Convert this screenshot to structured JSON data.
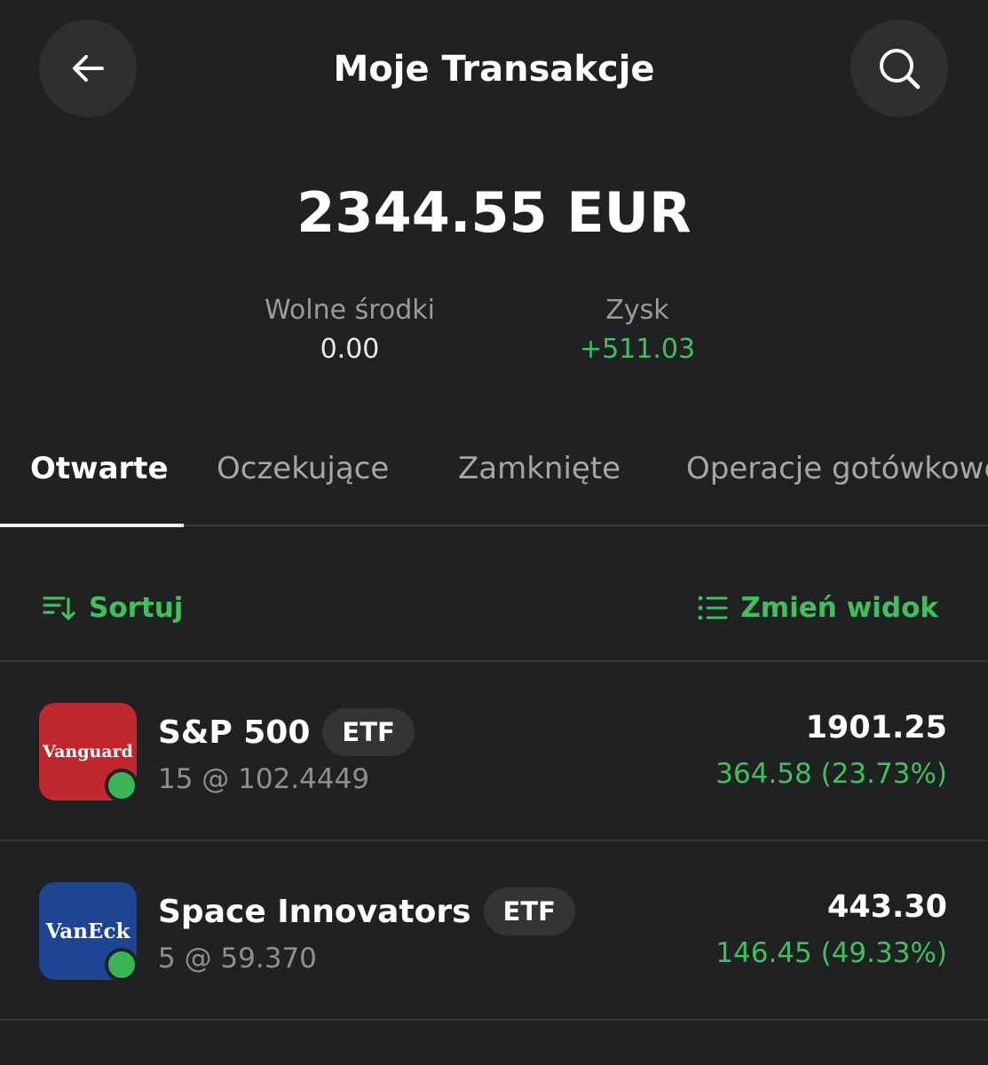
{
  "header": {
    "title": "Moje Transakcje",
    "back_icon": "arrow-left-icon",
    "search_icon": "search-icon"
  },
  "summary": {
    "balance": "2344.55 EUR",
    "free_funds_label": "Wolne środki",
    "free_funds_value": "0.00",
    "profit_label": "Zysk",
    "profit_value": "+511.03"
  },
  "tabs": [
    {
      "label": "Otwarte",
      "active": true
    },
    {
      "label": "Oczekujące",
      "active": false
    },
    {
      "label": "Zamknięte",
      "active": false
    },
    {
      "label": "Operacje gotówkowe",
      "active": false
    }
  ],
  "toolbar": {
    "sort_label": "Sortuj",
    "view_label": "Zmień widok"
  },
  "positions": [
    {
      "logo_text": "Vanguard",
      "name": "S&P 500",
      "badge": "ETF",
      "detail": "15 @ 102.4449",
      "value": "1901.25",
      "change": "364.58 (23.73%)"
    },
    {
      "logo_text": "VanEck",
      "name": "Space Innovators",
      "badge": "ETF",
      "detail": "5 @ 59.370",
      "value": "443.30",
      "change": "146.45 (49.33%)"
    }
  ],
  "colors": {
    "background": "#202122",
    "accent_green": "#3ec15d",
    "vanguard_red": "#c0282e",
    "vaneck_blue": "#1e4594"
  }
}
